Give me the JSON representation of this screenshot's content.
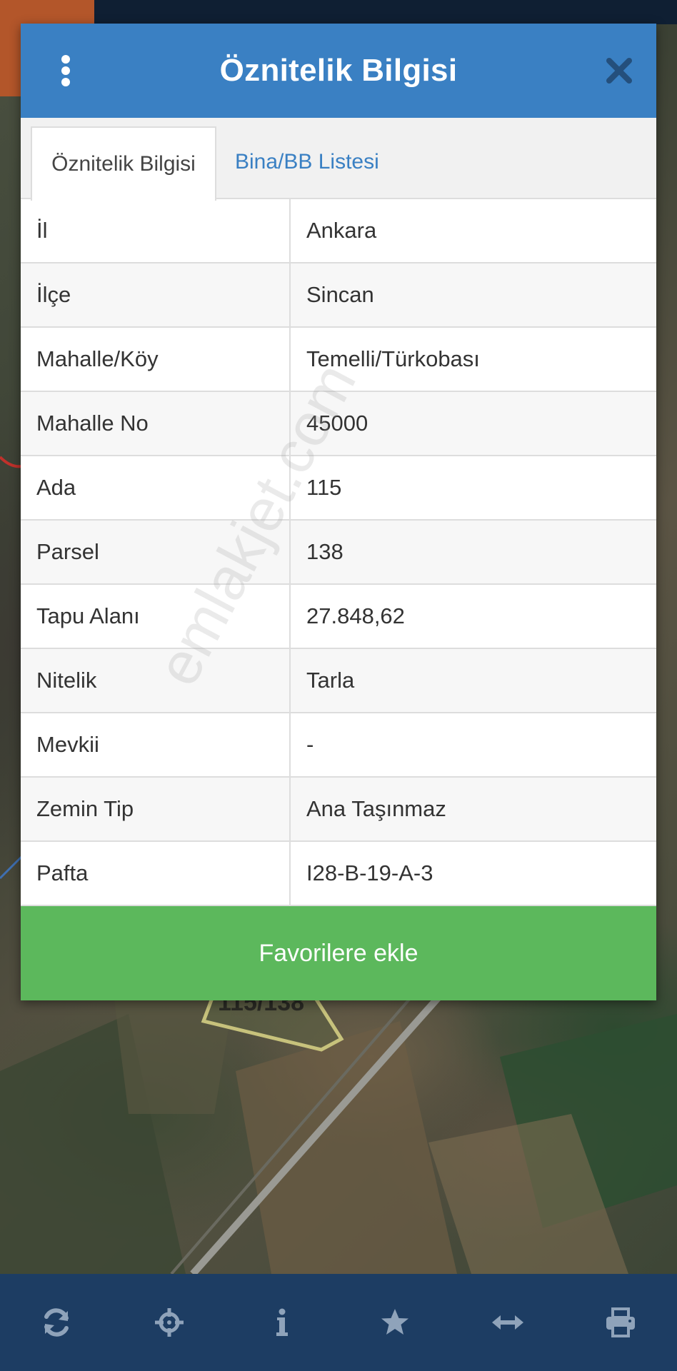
{
  "map": {
    "parcel_label": "115/138"
  },
  "dialog": {
    "title": "Öznitelik Bilgisi",
    "tabs": [
      {
        "label": "Öznitelik Bilgisi",
        "active": true
      },
      {
        "label": "Bina/BB Listesi",
        "active": false
      }
    ],
    "rows": [
      {
        "key": "İl",
        "value": "Ankara"
      },
      {
        "key": "İlçe",
        "value": "Sincan"
      },
      {
        "key": "Mahalle/Köy",
        "value": "Temelli/Türkobası"
      },
      {
        "key": "Mahalle No",
        "value": "45000"
      },
      {
        "key": "Ada",
        "value": "115"
      },
      {
        "key": "Parsel",
        "value": "138"
      },
      {
        "key": "Tapu Alanı",
        "value": "27.848,62"
      },
      {
        "key": "Nitelik",
        "value": "Tarla"
      },
      {
        "key": "Mevkii",
        "value": "-"
      },
      {
        "key": "Zemin Tip",
        "value": "Ana Taşınmaz"
      },
      {
        "key": "Pafta",
        "value": "I28-B-19-A-3"
      }
    ],
    "favorite_button": "Favorilere ekle"
  },
  "watermark": "emlakjet.com",
  "toolbar": {
    "icons": [
      "refresh-icon",
      "crosshair-icon",
      "info-icon",
      "star-icon",
      "measure-icon",
      "print-icon"
    ]
  },
  "colors": {
    "header": "#3a80c3",
    "favorite": "#5cb85c",
    "toolbar": "#1d3d63",
    "toolbar_icon": "#8fa3ba"
  }
}
